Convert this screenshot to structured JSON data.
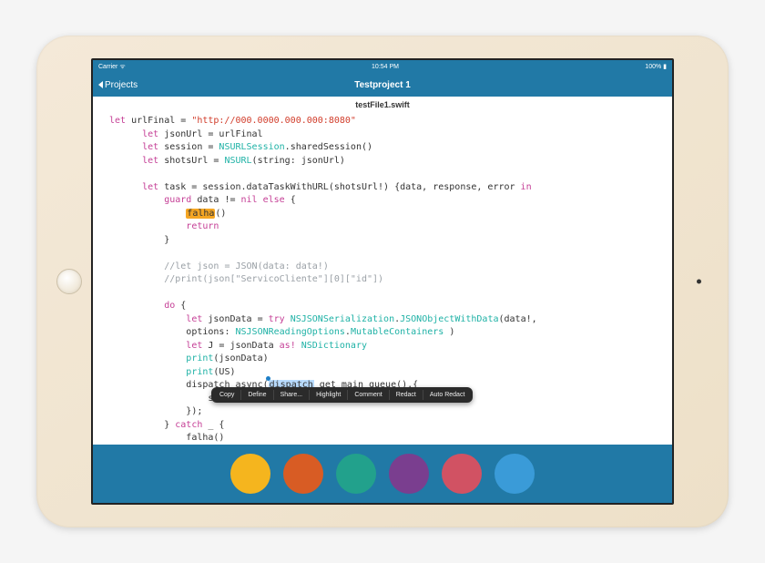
{
  "status": {
    "left": "Carrier ᯤ",
    "center": "10:54 PM",
    "right": "100% ▮"
  },
  "nav": {
    "back": "Projects",
    "title": "Testproject 1"
  },
  "file": {
    "name": "testFile1.swift"
  },
  "code": {
    "l1a": "let",
    "l1b": " urlFinal = ",
    "l1c": "\"http://000.0000.000.000:8080\"",
    "l2a": "let",
    "l2b": " jsonUrl = urlFinal",
    "l3a": "let",
    "l3b": " session = ",
    "l3c": "NSURLSession",
    "l3d": ".sharedSession()",
    "l4a": "let",
    "l4b": " shotsUrl = ",
    "l4c": "NSURL",
    "l4d": "(string: jsonUrl)",
    "l6a": "let",
    "l6b": " task = session.dataTaskWithURL(shotsUrl!) {data, response, error ",
    "l6c": "in",
    "l7a": "guard",
    "l7b": " data != ",
    "l7c": "nil",
    "l7d": " else",
    "l7e": " {",
    "l8a": "falha",
    "l8b": "()",
    "l9a": "return",
    "l10": "}",
    "l12": "//let json = JSON(data: data!)",
    "l13": "//print(json[\"ServicoCliente\"][0][\"id\"])",
    "l15a": "do",
    "l15b": " {",
    "l16a": "let",
    "l16b": " jsonData = ",
    "l16c": "try",
    "l16d": " ",
    "l16e": "NSJSONSerialization",
    "l16f": ".",
    "l16g": "JSONObjectWithData",
    "l16h": "(data!,",
    "l17a": "options: ",
    "l17b": "NSJSONReadingOptions",
    "l17c": ".",
    "l17d": "MutableContainers",
    "l17e": " )",
    "l18a": "let",
    "l18b": " J = jsonData ",
    "l18c": "as!",
    "l18d": " ",
    "l18e": "NSDictionary",
    "l19a": "print",
    "l19b": "(jsonData)",
    "l20a": "print",
    "l20b": "(US)",
    "l21a": "dispatch_async(",
    "l21b": "dispatch",
    "l21c": "_get_main_queue(),{",
    "l22": "sucesso()",
    "l23": "});",
    "l24a": "} ",
    "l24b": "catch",
    "l24c": " _ {",
    "l25": "falha()",
    "l26": "}",
    "l27": "}"
  },
  "menu": [
    "Copy",
    "Define",
    "Share...",
    "Highlight",
    "Comment",
    "Redact",
    "Auto Redact"
  ],
  "swatches": [
    "#f5b51e",
    "#d85c24",
    "#22a18c",
    "#7a3e8f",
    "#d15263",
    "#3a9bd8"
  ]
}
